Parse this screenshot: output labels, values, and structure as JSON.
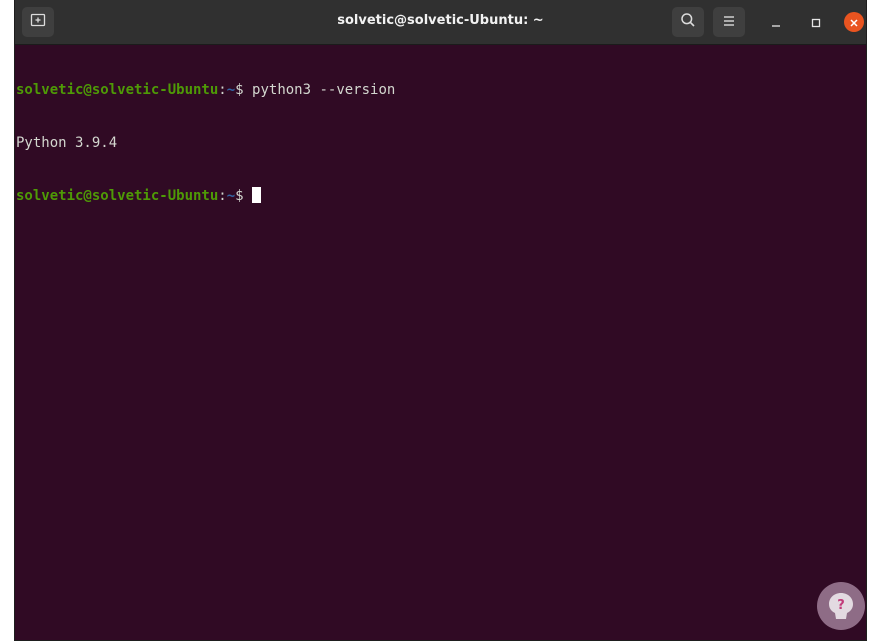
{
  "window": {
    "title": "solvetic@solvetic-Ubuntu: ~"
  },
  "toolbar": {
    "new_tab_icon": "new-tab-icon",
    "search_icon": "search-icon",
    "menu_icon": "hamburger-menu-icon"
  },
  "window_controls": {
    "minimize_icon": "minimize-icon",
    "maximize_icon": "maximize-icon",
    "close_icon": "close-icon"
  },
  "terminal": {
    "lines": [
      {
        "user_host": "solvetic@solvetic-Ubuntu",
        "colon": ":",
        "path": "~",
        "prompt": "$ ",
        "command": "python3 --version"
      },
      {
        "output": "Python 3.9.4"
      },
      {
        "user_host": "solvetic@solvetic-Ubuntu",
        "colon": ":",
        "path": "~",
        "prompt": "$ ",
        "command": ""
      }
    ]
  },
  "watermark": {
    "icon": "solvetic-logo-icon"
  },
  "colors": {
    "terminal_background": "#300a24",
    "titlebar_background": "#303030",
    "user_host": "#4e9a06",
    "path": "#3465a4",
    "close_button": "#e95420"
  }
}
